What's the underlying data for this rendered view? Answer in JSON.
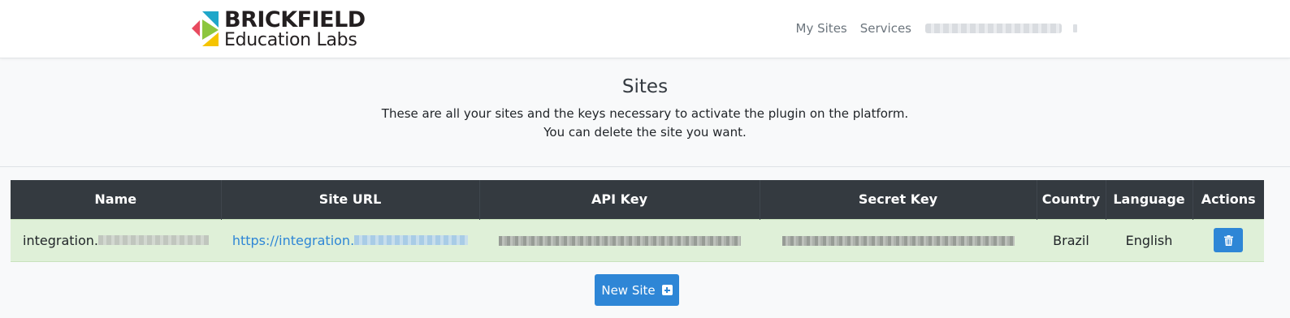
{
  "brand": {
    "line1": "BRICKFIELD",
    "line2": "Education Labs",
    "colors": {
      "red": "#e84a5f",
      "teal": "#1fa6c9",
      "green": "#8cc63f",
      "yellow": "#f5c400"
    }
  },
  "nav": {
    "my_sites": "My Sites",
    "services": "Services"
  },
  "header": {
    "title": "Sites",
    "description_line1": "These are all your sites and the keys necessary to activate the plugin on the platform.",
    "description_line2": "You can delete the site you want."
  },
  "table": {
    "columns": [
      "Name",
      "Site URL",
      "API Key",
      "Secret Key",
      "Country",
      "Language",
      "Actions"
    ],
    "rows": [
      {
        "name_prefix": "integration.",
        "url_prefix": "https://integration.",
        "country": "Brazil",
        "language": "English"
      }
    ]
  },
  "actions": {
    "new_site_label": "New Site"
  },
  "colors": {
    "primary": "#2e86d6",
    "table_header": "#343a40",
    "row_success": "#dff0d8"
  }
}
